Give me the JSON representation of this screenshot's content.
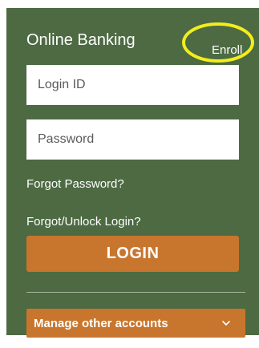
{
  "online_banking": {
    "title": "Online Banking",
    "enroll_label": "Enroll",
    "login_id_placeholder": "Login ID",
    "password_placeholder": "Password",
    "forgot_password_label": "Forgot Password?",
    "forgot_unlock_login_label": "Forgot/Unlock Login?",
    "login_button_label": "LOGIN",
    "manage_accounts_label": "Manage other accounts"
  },
  "icons": {
    "manage_chevron": "chevron-down-icon",
    "enroll_highlight": "highlight-ellipse"
  },
  "colors": {
    "panel_background": "#4d6a42",
    "accent_button": "#c8762e",
    "highlight_ellipse": "#f2ee1c",
    "text": "#ffffff"
  }
}
